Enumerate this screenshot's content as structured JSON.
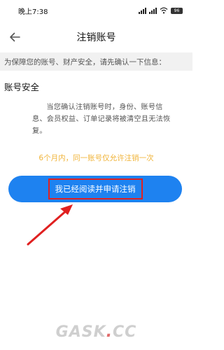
{
  "status_bar": {
    "time": "晚上7:38",
    "battery": "96"
  },
  "header": {
    "title": "注销账号"
  },
  "notice": {
    "text": "为保障您的账号、财产安全，请先确认一下信息："
  },
  "section": {
    "title": "账号安全",
    "description": "当您确认注销账号时，身份、账号信息、会员权益、订单记录将被清空且无法恢复。"
  },
  "limit_note": "6个月内，同一账号仅允许注销一次",
  "apply_button": {
    "label": "我已经阅读并申请注销"
  },
  "watermark": {
    "left": "GASK",
    "dot": ".",
    "right": "CC"
  },
  "colors": {
    "accent": "#1e82f0",
    "note": "#f0b43a",
    "highlight": "#e02020"
  }
}
